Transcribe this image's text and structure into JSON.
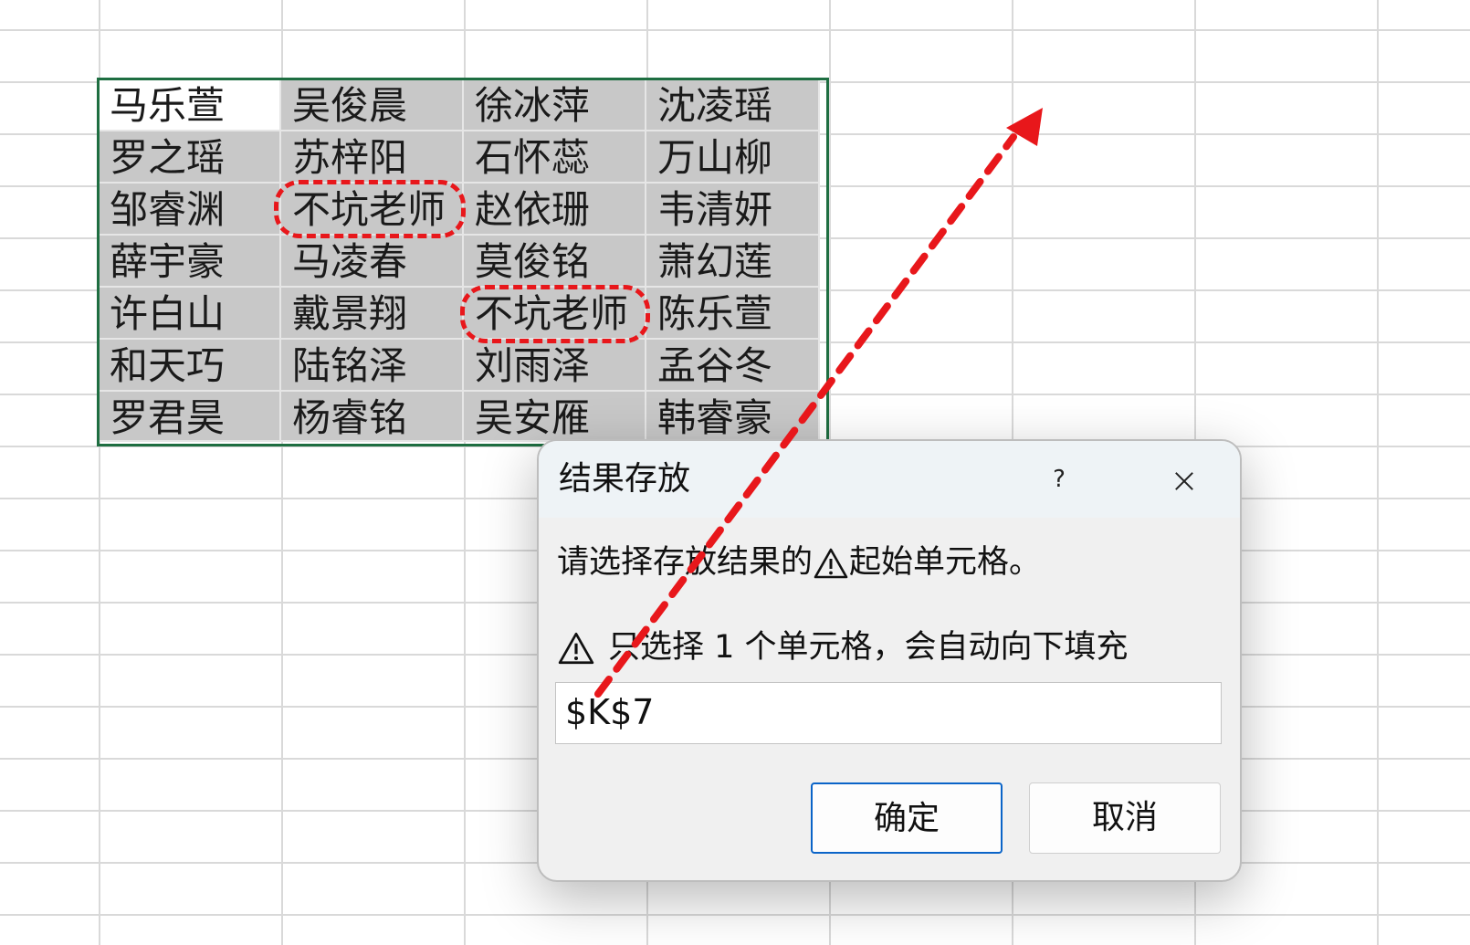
{
  "sheet": {
    "rows": [
      [
        "马乐萱",
        "吴俊晨",
        "徐冰萍",
        "沈凌瑶"
      ],
      [
        "罗之瑶",
        "苏梓阳",
        "石怀蕊",
        "万山柳"
      ],
      [
        "邹睿渊",
        "不坑老师",
        "赵依珊",
        "韦清妍"
      ],
      [
        "薛宇豪",
        "马凌春",
        "莫俊铭",
        "萧幻莲"
      ],
      [
        "许白山",
        "戴景翔",
        "不坑老师",
        "陈乐萱"
      ],
      [
        "和天巧",
        "陆铭泽",
        "刘雨泽",
        "孟谷冬"
      ],
      [
        "罗君昊",
        "杨睿铭",
        "吴安雁",
        "韩睿豪"
      ]
    ]
  },
  "dialog": {
    "title": "结果存放",
    "help": "?",
    "prompt_before": "请选择存放结果的",
    "prompt_after": "起始单元格。",
    "note": "只选择 1 个单元格，会自动向下填充",
    "input_value": "$K$7",
    "ok_label": "确定",
    "cancel_label": "取消"
  },
  "colors": {
    "selection_border": "#1e6e41",
    "annotation_red": "#e8171b",
    "ok_button_border": "#0a64c8"
  }
}
